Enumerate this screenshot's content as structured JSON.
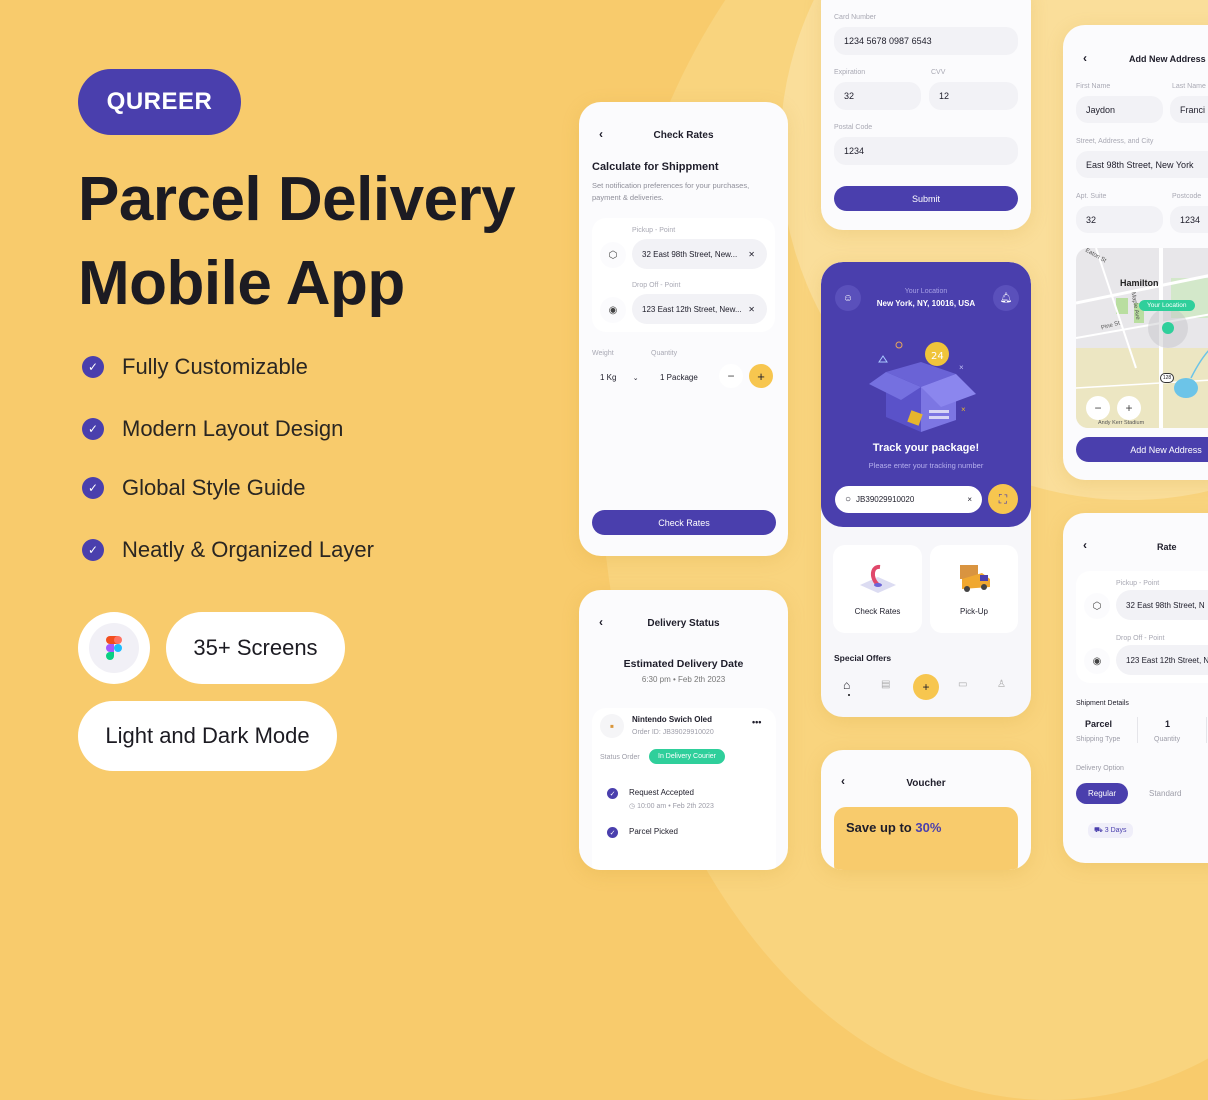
{
  "hero": {
    "brand": "QUREER",
    "title_line1": "Parcel Delivery",
    "title_line2": "Mobile App",
    "features": [
      "Fully Customizable",
      "Modern Layout Design",
      "Global Style Guide",
      "Neatly & Organized Layer"
    ],
    "screens_badge": "35+ Screens",
    "mode_badge": "Light and Dark Mode",
    "figma_icon": "figma-logo-icon"
  },
  "colors": {
    "background": "#f8cb6c",
    "primary": "#4a3fad",
    "accent": "#f7c64f",
    "success": "#2fcf9b"
  },
  "check_rates": {
    "title": "Check Rates",
    "heading": "Calculate for Shippment",
    "description": "Set notification preferences for your purchases, payment & deliveries.",
    "pickup_label": "Pickup - Point",
    "pickup_value": "32 East 98th Street, New...",
    "dropoff_label": "Drop Off - Point",
    "dropoff_value": "123 East 12th Street, New...",
    "weight_label": "Weight",
    "weight_value": "1 Kg",
    "quantity_label": "Quantity",
    "quantity_value": "1 Package",
    "minus": "−",
    "plus": "+",
    "button": "Check Rates"
  },
  "delivery_status": {
    "title": "Delivery Status",
    "heading": "Estimated Delivery Date",
    "datetime": "6:30 pm • Feb 2th 2023",
    "item_name": "Nintendo Swich Oled",
    "order_id": "Order ID: JB39029910020",
    "status_label": "Status Order",
    "status_badge": "In Delivery Courier",
    "more": "•••",
    "steps": [
      {
        "title": "Request Accepted",
        "time": "10:00 am • Feb 2th 2023"
      },
      {
        "title": "Parcel Picked",
        "time": ""
      }
    ]
  },
  "payment": {
    "card_label": "Card Number",
    "card_value": "1234 5678 0987 6543",
    "exp_label": "Expiration",
    "exp_value": "32",
    "cvv_label": "CVV",
    "cvv_value": "12",
    "postal_label": "Postal Code",
    "postal_value": "1234",
    "button": "Submit"
  },
  "tracking": {
    "location_label": "Your Location",
    "location_value": "New York, NY, 10016, USA",
    "heading": "Track your package!",
    "subheading": "Please enter your tracking number",
    "search_value": "JB39029910020",
    "clear": "×",
    "tiles": [
      "Check Rates",
      "Pick-Up"
    ],
    "offers_label": "Special Offers",
    "nav_plus": "+"
  },
  "voucher": {
    "title": "Voucher",
    "promo_prefix": "Save up to ",
    "promo_value": "30%"
  },
  "address": {
    "title": "Add New Address",
    "first_name_label": "First Name",
    "first_name_value": "Jaydon",
    "last_name_label": "Last Name",
    "last_name_value": "Franci",
    "street_label": "Street, Address, and City",
    "street_value": "East 98th Street, New York",
    "apt_label": "Apt. Suite",
    "apt_value": "32",
    "postcode_label": "Postcode",
    "postcode_value": "1234",
    "map_city": "Hamilton",
    "map_pin_label": "Your Location",
    "map_streets": [
      "Eaton St",
      "Pine St",
      "Maple Ave"
    ],
    "map_route": "128",
    "map_poi": "Andy Kerr Stadium",
    "zoom_out": "−",
    "zoom_in": "+",
    "button": "Add New Address"
  },
  "rate": {
    "title": "Rate",
    "pickup_label": "Pickup - Point",
    "pickup_value": "32 East 98th Street, N",
    "dropoff_label": "Drop Off - Point",
    "dropoff_value": "123 East 12th Street, N",
    "details_label": "Shipment Details",
    "type_value": "Parcel",
    "type_label": "Shipping Type",
    "qty_value": "1",
    "qty_label": "Quantity",
    "option_label": "Delivery Option",
    "options": [
      "Regular",
      "Standard"
    ],
    "days_badge": "3 Days"
  },
  "back_glyph": "‹"
}
